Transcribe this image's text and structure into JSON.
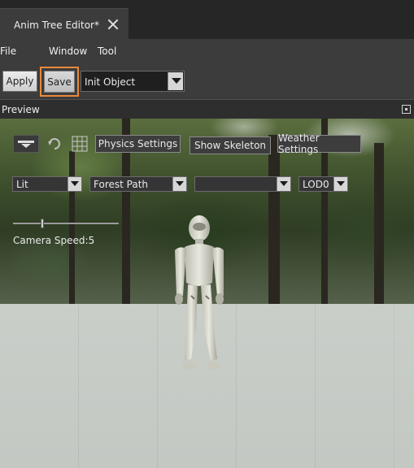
{
  "tab": {
    "title": "Anim Tree Editor*"
  },
  "menu": {
    "items": [
      "File",
      "Window",
      "Tool"
    ]
  },
  "toolbar": {
    "apply_label": "Apply",
    "save_label": "Save",
    "object_select": "Init Object"
  },
  "preview": {
    "title": "Preview",
    "buttons": {
      "physics": "Physics Settings",
      "skeleton": "Show Skeleton",
      "weather": "Weather Settings"
    },
    "dropdowns": {
      "render_mode": "Lit",
      "environment": "Forest Path",
      "extra": "",
      "lod": "LOD0"
    },
    "camera_speed_label": "Camera Speed:5",
    "camera_speed_value": 5
  },
  "colors": {
    "highlight": "#e8893a",
    "panel": "#3c3c3c",
    "tabbar": "#262626",
    "floor": "#c6cbc6"
  },
  "icons": [
    "close-icon",
    "pin-icon",
    "camera-icon",
    "rotate-icon",
    "grid-icon",
    "chevron-down-icon"
  ]
}
